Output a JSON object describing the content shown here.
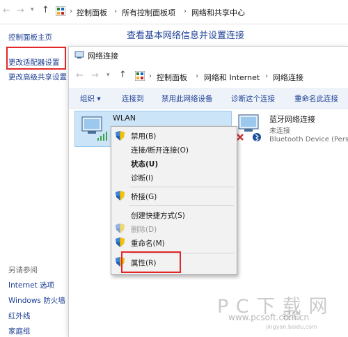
{
  "outer": {
    "breadcrumb": [
      "控制面板",
      "所有控制面板项",
      "网络和共享中心"
    ],
    "heading": "查看基本网络信息并设置连接",
    "left_links": [
      "控制面板主页",
      "更改适配器设置",
      "更改高级共享设置"
    ],
    "see_also_title": "另请参阅",
    "see_also": [
      "Internet 选项",
      "Windows 防火墙",
      "红外线",
      "家庭组"
    ]
  },
  "inner": {
    "title": "网络连接",
    "breadcrumb": [
      "控制面板",
      "网络和 Internet",
      "网络连接"
    ],
    "commands": [
      "组织 ▾",
      "连接到",
      "禁用此网络设备",
      "诊断这个连接",
      "重命名此连接"
    ]
  },
  "connections": {
    "wlan": {
      "name": "WLAN"
    },
    "bluetooth": {
      "name": "蓝牙网络连接",
      "status": "未连接",
      "device": "Bluetooth Device (Pers"
    }
  },
  "context_menu": {
    "items": [
      "禁用(B)",
      "连接/断开连接(O)",
      "状态(U)",
      "诊断(I)",
      "桥接(G)",
      "创建快捷方式(S)",
      "删除(D)",
      "重命名(M)",
      "属性(R)"
    ]
  },
  "watermark": {
    "brand": "P C 下 载 网",
    "url": "www.pcsoft.com.cn",
    "baidu": "经验",
    "baidu_url": "jingyan.baidu.com"
  },
  "colors": {
    "accent_link": "#1c3f94",
    "highlight_box": "#e3262a",
    "cmdbar_bg": "#eef3fa"
  }
}
